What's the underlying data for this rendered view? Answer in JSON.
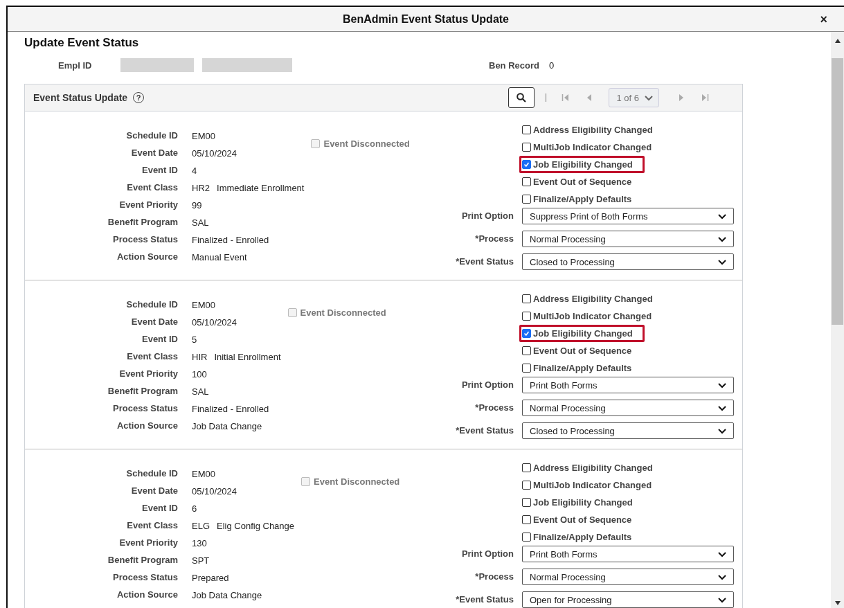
{
  "dialog": {
    "title": "BenAdmin Event Status Update",
    "close": "×"
  },
  "page_title": "Update Event Status",
  "employee": {
    "empl_id_label": "Empl ID",
    "ben_record_label": "Ben Record",
    "ben_record": "0"
  },
  "panel": {
    "title": "Event Status Update",
    "help": "?",
    "pager": "1 of 6"
  },
  "events": [
    {
      "fields": [
        {
          "label": "Schedule ID",
          "value": "EM00"
        },
        {
          "label": "Event Date",
          "value": "05/10/2024"
        },
        {
          "label": "Event ID",
          "value": "4"
        },
        {
          "label": "Event Class",
          "value": "HR2",
          "description": "Immediate Enrollment"
        },
        {
          "label": "Event Priority",
          "value": "99"
        },
        {
          "label": "Benefit Program",
          "value": "SAL"
        },
        {
          "label": "Process Status",
          "value": "Finalized - Enrolled"
        },
        {
          "label": "Action Source",
          "value": "Manual Event"
        }
      ],
      "event_disconnected": {
        "label": "Event Disconnected",
        "checked": false,
        "disabled": true
      },
      "flags": [
        {
          "label": "Address Eligibility Changed",
          "checked": false,
          "highlighted": false
        },
        {
          "label": "MultiJob Indicator Changed",
          "checked": false,
          "highlighted": false
        },
        {
          "label": "Job Eligibility Changed",
          "checked": true,
          "highlighted": true
        },
        {
          "label": "Event Out of Sequence",
          "checked": false,
          "highlighted": false
        },
        {
          "label": "Finalize/Apply Defaults",
          "checked": false,
          "highlighted": false
        }
      ],
      "selects": [
        {
          "label": "Print Option",
          "value": "Suppress Print of Both Forms"
        },
        {
          "label": "*Process",
          "value": "Normal Processing"
        },
        {
          "label": "*Event Status",
          "value": "Closed to Processing"
        }
      ]
    },
    {
      "fields": [
        {
          "label": "Schedule ID",
          "value": "EM00"
        },
        {
          "label": "Event Date",
          "value": "05/10/2024"
        },
        {
          "label": "Event ID",
          "value": "5"
        },
        {
          "label": "Event Class",
          "value": "HIR",
          "description": "Initial Enrollment"
        },
        {
          "label": "Event Priority",
          "value": "100"
        },
        {
          "label": "Benefit Program",
          "value": "SAL"
        },
        {
          "label": "Process Status",
          "value": "Finalized - Enrolled"
        },
        {
          "label": "Action Source",
          "value": "Job Data Change"
        }
      ],
      "event_disconnected": {
        "label": "Event Disconnected",
        "checked": false,
        "disabled": true
      },
      "flags": [
        {
          "label": "Address Eligibility Changed",
          "checked": false,
          "highlighted": false
        },
        {
          "label": "MultiJob Indicator Changed",
          "checked": false,
          "highlighted": false
        },
        {
          "label": "Job Eligibility Changed",
          "checked": true,
          "highlighted": true
        },
        {
          "label": "Event Out of Sequence",
          "checked": false,
          "highlighted": false
        },
        {
          "label": "Finalize/Apply Defaults",
          "checked": false,
          "highlighted": false
        }
      ],
      "selects": [
        {
          "label": "Print Option",
          "value": "Print Both Forms"
        },
        {
          "label": "*Process",
          "value": "Normal Processing"
        },
        {
          "label": "*Event Status",
          "value": "Closed to Processing"
        }
      ]
    },
    {
      "fields": [
        {
          "label": "Schedule ID",
          "value": "EM00"
        },
        {
          "label": "Event Date",
          "value": "05/10/2024"
        },
        {
          "label": "Event ID",
          "value": "6"
        },
        {
          "label": "Event Class",
          "value": "ELG",
          "description": "Elig Config Change"
        },
        {
          "label": "Event Priority",
          "value": "130"
        },
        {
          "label": "Benefit Program",
          "value": "SPT"
        },
        {
          "label": "Process Status",
          "value": "Prepared"
        },
        {
          "label": "Action Source",
          "value": "Job Data Change"
        }
      ],
      "event_disconnected": {
        "label": "Event Disconnected",
        "checked": false,
        "disabled": true
      },
      "flags": [
        {
          "label": "Address Eligibility Changed",
          "checked": false,
          "highlighted": false
        },
        {
          "label": "MultiJob Indicator Changed",
          "checked": false,
          "highlighted": false
        },
        {
          "label": "Job Eligibility Changed",
          "checked": false,
          "highlighted": false
        },
        {
          "label": "Event Out of Sequence",
          "checked": false,
          "highlighted": false
        },
        {
          "label": "Finalize/Apply Defaults",
          "checked": false,
          "highlighted": false
        }
      ],
      "selects": [
        {
          "label": "Print Option",
          "value": "Print Both Forms"
        },
        {
          "label": "*Process",
          "value": "Normal Processing"
        },
        {
          "label": "*Event Status",
          "value": "Open for Processing"
        }
      ]
    }
  ]
}
